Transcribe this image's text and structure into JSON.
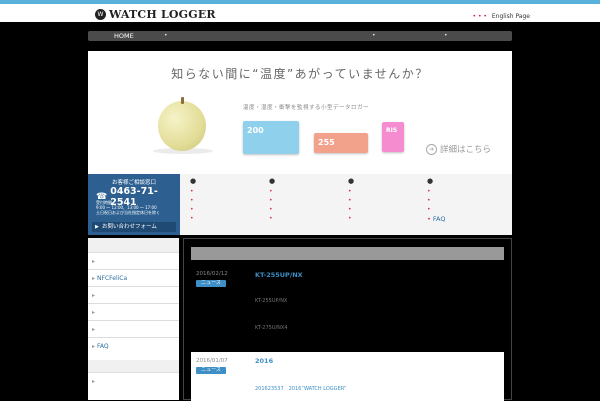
{
  "colors": {
    "accent_bar": "#59b1d9",
    "nav_bar": "#4b4b4b",
    "contact_bg": "#2d6091",
    "badge": "#3d8fc6"
  },
  "header": {
    "logo_mark": "W",
    "logo_text": "WATCH LOGGER",
    "english_link": "English Page"
  },
  "nav": {
    "home": "HOME",
    "separators": [
      "•",
      "•",
      "•"
    ]
  },
  "hero": {
    "title": "知らない間に“温度”あがっていませんか？",
    "subtitle": "温度・湿度・衝撃を監視する小型データロガー",
    "device_labels": [
      "200",
      "255",
      "RIS"
    ],
    "detail_link": "詳細はこちら"
  },
  "contact": {
    "title": "お客様ご相談窓口",
    "phone": "0463-71-2541",
    "hours_label": "受付時間",
    "hours": "9:00 ～ 12:00、13:00 ～ 17:00",
    "holidays": "土日祝日および当社指定休日を除く",
    "form_button": "お問い合わせフォーム"
  },
  "links": {
    "bullets": [
      "●",
      "●",
      "●",
      "●"
    ],
    "faq": "FAQ"
  },
  "sidebar": {
    "items": [
      "NFCFeliCa",
      "",
      "",
      "FAQ"
    ]
  },
  "news": [
    {
      "date": "2016/02/12",
      "badge": "ニュース",
      "title": "KT-255UP/NX",
      "lines": [
        "KT-255UP/NX",
        "KT-275U/NX4"
      ]
    },
    {
      "date": "2016/01/07",
      "badge": "ニュース",
      "title": "2016",
      "lines": [
        "201623537　2016“WATCH LOGGER”"
      ]
    }
  ]
}
